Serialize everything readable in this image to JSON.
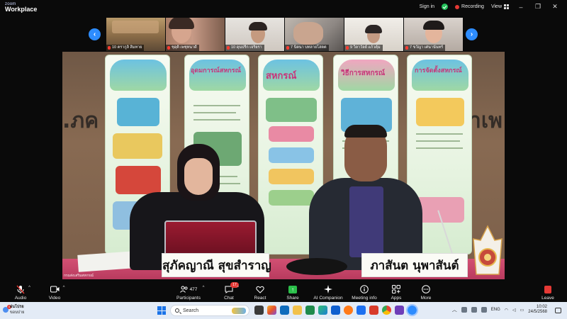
{
  "titlebar": {
    "logo_line1": "zoom",
    "logo_line2": "Workplace",
    "signin": "Sign in",
    "recording": "Recording",
    "view": "View"
  },
  "thumbnails": [
    {
      "name": "10 ตรากูลิ สิมทาย"
    },
    {
      "name": "ชุดุติ  เพชุทนาดี"
    },
    {
      "name": "10 ดุนปรีก เจริยรา"
    },
    {
      "name": "7 นิตนา บทลายโสตต"
    },
    {
      "name": "9 วิลาวัลย์  แก้วคุ้ม"
    },
    {
      "name": "7 ขวัญา เศนานันทร์"
    }
  ],
  "main_video": {
    "nameplate_left": "สุภัคญาณี สุขสำราญ",
    "nameplate_right": "ภาสันต นุพาสันต์",
    "banner_titles": [
      "",
      "อุดมการณ์สหกรณ์",
      "สหกรณ์",
      "วิธีการสหกรณ์",
      "การจัดตั้งสหกรณ์"
    ],
    "watermark": "กรมส่งเสริมสหกรณ์"
  },
  "toolbar": {
    "audio": "Audio",
    "video": "Video",
    "participants": "Participants",
    "participants_count": "477",
    "chat": "Chat",
    "chat_badge": "17",
    "react": "React",
    "share": "Share",
    "ai_companion": "AI Companion",
    "meeting_info": "Meeting info",
    "apps": "Apps",
    "more": "More",
    "leave": "Leave"
  },
  "taskbar": {
    "weather_line1": "ฝนโปรย",
    "weather_line2": "ขอบปาย",
    "weather_badge": "4",
    "search_placeholder": "Search",
    "language": "ENG",
    "time": "10:02",
    "date": "24/5/2568"
  },
  "colors": {
    "accent": "#2d8cff",
    "record": "#e53935",
    "share": "#2bbf4a",
    "leave": "#e53935"
  }
}
